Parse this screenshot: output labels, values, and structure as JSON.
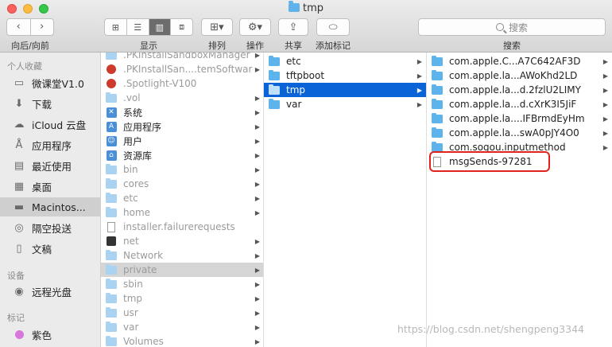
{
  "window": {
    "title": "tmp"
  },
  "toolbar": {
    "nav_label": "向后/向前",
    "view_label": "显示",
    "arrange_label": "排列",
    "action_label": "操作",
    "share_label": "共享",
    "tags_label": "添加标记",
    "search_placeholder": "搜索",
    "search_label": "搜索"
  },
  "sidebar": {
    "favorites_header": "个人收藏",
    "favorites": [
      {
        "label": "微课堂V1.0",
        "icon": "folder-icon"
      },
      {
        "label": "下载",
        "icon": "download-icon"
      },
      {
        "label": "iCloud 云盘",
        "icon": "cloud-icon"
      },
      {
        "label": "应用程序",
        "icon": "apps-icon"
      },
      {
        "label": "最近使用",
        "icon": "recents-icon"
      },
      {
        "label": "桌面",
        "icon": "desktop-icon"
      },
      {
        "label": "Macintos...",
        "icon": "disk-icon"
      },
      {
        "label": "隔空投送",
        "icon": "airdrop-icon"
      },
      {
        "label": "文稿",
        "icon": "document-icon"
      }
    ],
    "devices_header": "设备",
    "devices": [
      {
        "label": "远程光盘",
        "icon": "disc-icon"
      }
    ],
    "tags_header": "标记",
    "tags": [
      {
        "label": "紫色",
        "color": "#d776dc"
      }
    ]
  },
  "column1": {
    "items": [
      {
        "name": ".PKInstallSandboxManager",
        "icon": "folder-icon"
      },
      {
        "name": ".PKInstallSan....temSoftware",
        "icon": "restricted-folder-icon"
      },
      {
        "name": ".Spotlight-V100",
        "icon": "restricted-folder-icon"
      },
      {
        "name": ".vol",
        "icon": "folder-icon"
      },
      {
        "name": "系统",
        "icon": "system-folder-icon"
      },
      {
        "name": "应用程序",
        "icon": "apps-folder-icon"
      },
      {
        "name": "用户",
        "icon": "users-folder-icon"
      },
      {
        "name": "资源库",
        "icon": "library-folder-icon"
      },
      {
        "name": "bin",
        "icon": "folder-icon"
      },
      {
        "name": "cores",
        "icon": "folder-icon"
      },
      {
        "name": "etc",
        "icon": "alias-folder-icon"
      },
      {
        "name": "home",
        "icon": "alias-icon"
      },
      {
        "name": "installer.failurerequests",
        "icon": "file-icon"
      },
      {
        "name": "net",
        "icon": "alias-icon"
      },
      {
        "name": "Network",
        "icon": "folder-icon"
      },
      {
        "name": "private",
        "icon": "folder-icon"
      },
      {
        "name": "sbin",
        "icon": "folder-icon"
      },
      {
        "name": "tmp",
        "icon": "alias-folder-icon"
      },
      {
        "name": "usr",
        "icon": "folder-icon"
      },
      {
        "name": "var",
        "icon": "alias-folder-icon"
      },
      {
        "name": "Volumes",
        "icon": "folder-icon"
      }
    ]
  },
  "column2": {
    "items": [
      {
        "name": "etc"
      },
      {
        "name": "tftpboot"
      },
      {
        "name": "tmp"
      },
      {
        "name": "var"
      }
    ]
  },
  "column3": {
    "items": [
      {
        "name": "com.apple.C...A7C642AF3D",
        "icon": "folder-icon"
      },
      {
        "name": "com.apple.la...AWoKhd2LD",
        "icon": "folder-icon"
      },
      {
        "name": "com.apple.la...d.2fzlU2LIMY",
        "icon": "folder-icon"
      },
      {
        "name": "com.apple.la...d.cXrK3I5JiF",
        "icon": "folder-icon"
      },
      {
        "name": "com.apple.la....IFBrmdEyHm",
        "icon": "folder-icon"
      },
      {
        "name": "com.apple.la...swA0pJY4O0",
        "icon": "folder-icon"
      },
      {
        "name": "com.sogou.inputmethod",
        "icon": "folder-icon"
      },
      {
        "name": "msgSends-97281",
        "icon": "file-icon"
      }
    ]
  },
  "watermark": "https://blog.csdn.net/shengpeng3344"
}
